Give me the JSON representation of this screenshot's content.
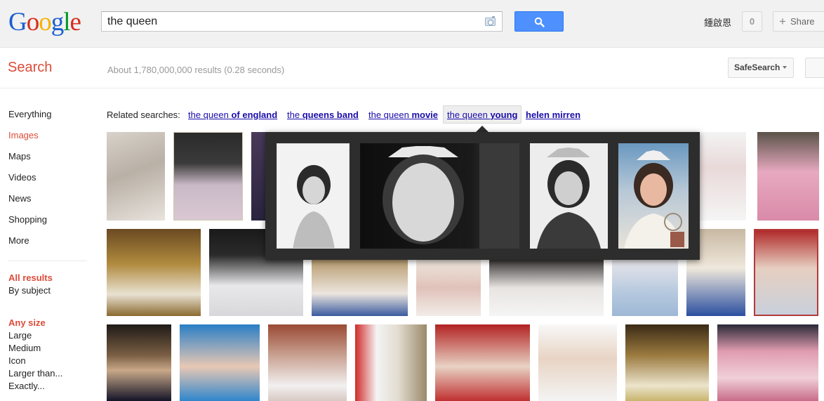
{
  "header": {
    "logo": "Google",
    "search_value": "the queen",
    "user_name": "鍾啟恩",
    "notification_count": "0",
    "share_label": "Share"
  },
  "subbar": {
    "title": "Search",
    "results_count": "About 1,780,000,000 results (0.28 seconds)",
    "safesearch_label": "SafeSearch"
  },
  "sidebar": {
    "items": [
      {
        "label": "Everything",
        "active": false
      },
      {
        "label": "Images",
        "active": true
      },
      {
        "label": "Maps",
        "active": false
      },
      {
        "label": "Videos",
        "active": false
      },
      {
        "label": "News",
        "active": false
      },
      {
        "label": "Shopping",
        "active": false
      },
      {
        "label": "More",
        "active": false
      }
    ],
    "results_filter": {
      "heading": "All results",
      "options": [
        "By subject"
      ]
    },
    "size_filter": {
      "heading": "Any size",
      "options": [
        "Large",
        "Medium",
        "Icon",
        "Larger than...",
        "Exactly..."
      ]
    }
  },
  "related": {
    "label": "Related searches:",
    "items": [
      {
        "plain": "the queen ",
        "bold": "of england"
      },
      {
        "plain": "the ",
        "bold": "queens band"
      },
      {
        "plain": "the queen ",
        "bold": "movie"
      },
      {
        "plain": "the queen ",
        "bold": "young"
      },
      {
        "plain": "",
        "bold": "helen mirren"
      }
    ],
    "selected_index": 3
  },
  "colors": {
    "accent_red": "#dd4b39",
    "link_blue": "#1a0dab",
    "button_blue": "#4d90fe",
    "popup_bg": "#2d2d2d"
  }
}
